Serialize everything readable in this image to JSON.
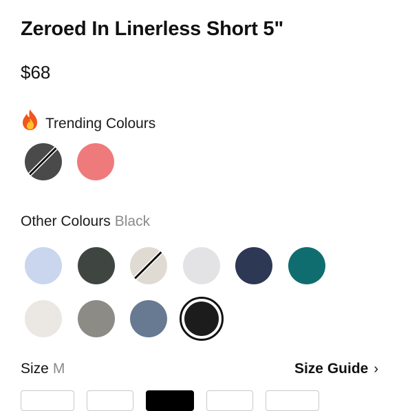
{
  "product": {
    "title": "Zeroed In Linerless Short 5\"",
    "price": "$68"
  },
  "trending": {
    "icon": "fire-icon",
    "label": "Trending Colours",
    "swatches": [
      {
        "name": "swatch-trending-1",
        "color": "#4a4a4a",
        "sold_out": true
      },
      {
        "name": "swatch-trending-2",
        "color": "#ef7a7c",
        "sold_out": false
      }
    ]
  },
  "other": {
    "label": "Other Colours",
    "selected_name": "Black",
    "swatches": [
      {
        "color": "#c9d6ee",
        "sold_out": false
      },
      {
        "color": "#3f4541",
        "sold_out": false
      },
      {
        "color": "#dfdbd3",
        "sold_out": true
      },
      {
        "color": "#e3e3e5",
        "sold_out": false
      },
      {
        "color": "#2c3854",
        "sold_out": false
      },
      {
        "color": "#0f6d70",
        "sold_out": false
      },
      {
        "color": "#ebe7e2",
        "sold_out": false
      },
      {
        "color": "#8c8b86",
        "sold_out": false
      },
      {
        "color": "#687a92",
        "sold_out": false
      },
      {
        "color": "#1c1c1c",
        "sold_out": false,
        "selected": true
      }
    ]
  },
  "size": {
    "label": "Size",
    "selected": "M",
    "guide_label": "Size Guide",
    "guide_icon": "chevron-right-icon"
  }
}
